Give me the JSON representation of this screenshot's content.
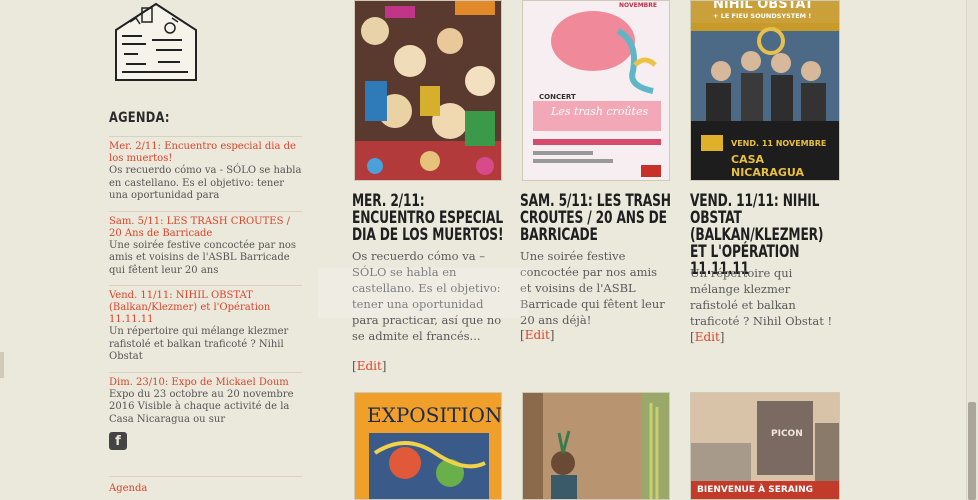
{
  "sidebar": {
    "agenda_title": "AGENDA:",
    "items": [
      {
        "link": "Mer. 2/11: Encuentro especial dia de los muertos!",
        "desc": "Os recuerdo cómo va - SÓLO se habla en castellano. Es el objetivo: tener una oportunidad para"
      },
      {
        "link": "Sam. 5/11: LES TRASH CROUTES / 20 Ans de Barricade",
        "desc": "Une soirée festive concoctée par nos amis et voisins de l'ASBL Barricade qui fêtent leur 20 ans"
      },
      {
        "link": "Vend. 11/11: NIHIL OBSTAT (Balkan/Klezmer) et l'Opération 11.11.11",
        "desc": "Un répertoire qui mélange klezmer rafistolé et balkan traficoté ? Nihil Obstat"
      },
      {
        "link": "Dim. 23/10: Expo de Mickael Doum",
        "desc": "Expo du 23 octobre au 20 novembre 2016 Visible à chaque activité de la Casa Nicaragua ou sur"
      }
    ],
    "facebook_icon": "f",
    "bottom_link": "Agenda"
  },
  "posts": [
    {
      "title": "MER. 2/11: ENCUENTRO ESPECIAL DIA DE LOS MUERTOS!",
      "excerpt": "Os recuerdo cómo va – SÓLO se habla en castellano. Es el objetivo: tener una oportunidad para practicar, así que no se admite el francés...",
      "edit": "Edit"
    },
    {
      "title": "SAM. 5/11: LES TRASH CROUTES / 20 ANS DE BARRICADE",
      "excerpt": "Une soirée festive concoctée par nos amis et voisins de l'ASBL Barricade qui fêtent leur 20 ans déjà!",
      "edit": "Edit",
      "poster_lines": [
        "NOVEMBRE",
        "CONCERT",
        "Les trash croûtes"
      ]
    },
    {
      "title": "VEND. 11/11: NIHIL OBSTAT (BALKAN/KLEZMER) ET L'OPÉRATION 11.11.11",
      "excerpt": "Un répertoire qui mélange klezmer rafistolé et balkan traficoté ? Nihil Obstat !",
      "edit": "Edit",
      "poster_lines": [
        "NIHIL OBSTAT",
        "+ LE FIEU SOUNDSYSTEM !",
        "VEND. 11 NOVEMBRE",
        "CASA NICARAGUA"
      ]
    }
  ],
  "bottom_images": [
    {
      "text": "EXPOSITION"
    },
    {
      "text": ""
    },
    {
      "text": "BIENVENUE À SERAING",
      "sign": "PICON"
    }
  ]
}
